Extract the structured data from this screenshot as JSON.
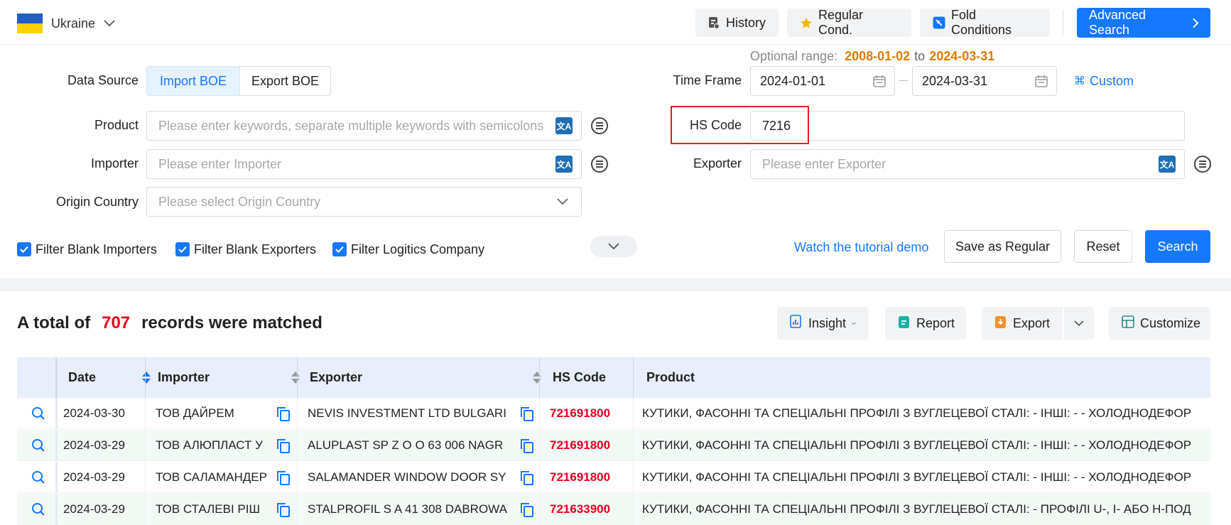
{
  "header": {
    "country": "Ukraine",
    "history": "History",
    "regular_cond": "Regular Cond.",
    "fold_conditions": "Fold Conditions",
    "advanced_search": "Advanced Search"
  },
  "form": {
    "optional_range_label": "Optional range:",
    "range_start": "2008-01-02",
    "range_to": "to",
    "range_end": "2024-03-31",
    "data_source_label": "Data Source",
    "import_boe": "Import BOE",
    "export_boe": "Export BOE",
    "time_frame_label": "Time Frame",
    "date_from": "2024-01-01",
    "date_to": "2024-03-31",
    "custom": "Custom",
    "product_label": "Product",
    "product_placeholder": "Please enter keywords, separate multiple keywords with semicolons",
    "hs_code_label": "HS Code",
    "hs_code_value": "7216",
    "importer_label": "Importer",
    "importer_placeholder": "Please enter Importer",
    "exporter_label": "Exporter",
    "exporter_placeholder": "Please enter Exporter",
    "origin_label": "Origin Country",
    "origin_placeholder": "Please select Origin Country",
    "filter_importers": "Filter Blank Importers",
    "filter_exporters": "Filter Blank Exporters",
    "filter_logistics": "Filter Logitics Company",
    "tutorial": "Watch the tutorial demo",
    "save_regular": "Save as Regular",
    "reset": "Reset",
    "search": "Search"
  },
  "results": {
    "prefix": "A total of",
    "count": "707",
    "suffix": "records were matched",
    "insight": "Insight",
    "report": "Report",
    "export": "Export",
    "customize": "Customize"
  },
  "table": {
    "columns": {
      "date": "Date",
      "importer": "Importer",
      "exporter": "Exporter",
      "hs_code": "HS Code",
      "product": "Product"
    },
    "rows": [
      {
        "date": "2024-03-30",
        "importer": "ТОВ ДАЙРЕМ",
        "exporter": "NEVIS INVESTMENT LTD BULGARI",
        "hs": "721691800",
        "product": "КУТИКИ, ФАСОННІ ТА СПЕЦІАЛЬНІ ПРОФІЛІ З ВУГЛЕЦЕВОЇ СТАЛІ: - ІНШІ: - - ХОЛОДНОДЕФОР"
      },
      {
        "date": "2024-03-29",
        "importer": "ТОВ АЛЮПЛАСТ У",
        "exporter": "ALUPLAST SP Z O O 63 006 NAGR",
        "hs": "721691800",
        "product": "КУТИКИ, ФАСОННІ ТА СПЕЦІАЛЬНІ ПРОФІЛІ З ВУГЛЕЦЕВОЇ СТАЛІ: - ІНШІ: - - ХОЛОДНОДЕФОР"
      },
      {
        "date": "2024-03-29",
        "importer": "ТОВ САЛАМАНДЕР",
        "exporter": "SALAMANDER WINDOW DOOR SY",
        "hs": "721691800",
        "product": "КУТИКИ, ФАСОННІ ТА СПЕЦІАЛЬНІ ПРОФІЛІ З ВУГЛЕЦЕВОЇ СТАЛІ: - ІНШІ: - - ХОЛОДНОДЕФОР"
      },
      {
        "date": "2024-03-29",
        "importer": "ТОВ СТАЛЕВІ РІШ",
        "exporter": "STALPROFIL S A 41 308 DABROWA",
        "hs": "721633900",
        "product": "КУТИКИ, ФАСОННІ ТА СПЕЦІАЛЬНІ ПРОФІЛІ З ВУГЛЕЦЕВОЇ СТАЛІ: - ПРОФІЛІ U-, I- АБО Н-ПОД"
      }
    ]
  },
  "colors": {
    "accent": "#1677ff",
    "hs_code": "#e6001e",
    "range_date": "#e07b00",
    "highlight_box": "#e02020"
  }
}
